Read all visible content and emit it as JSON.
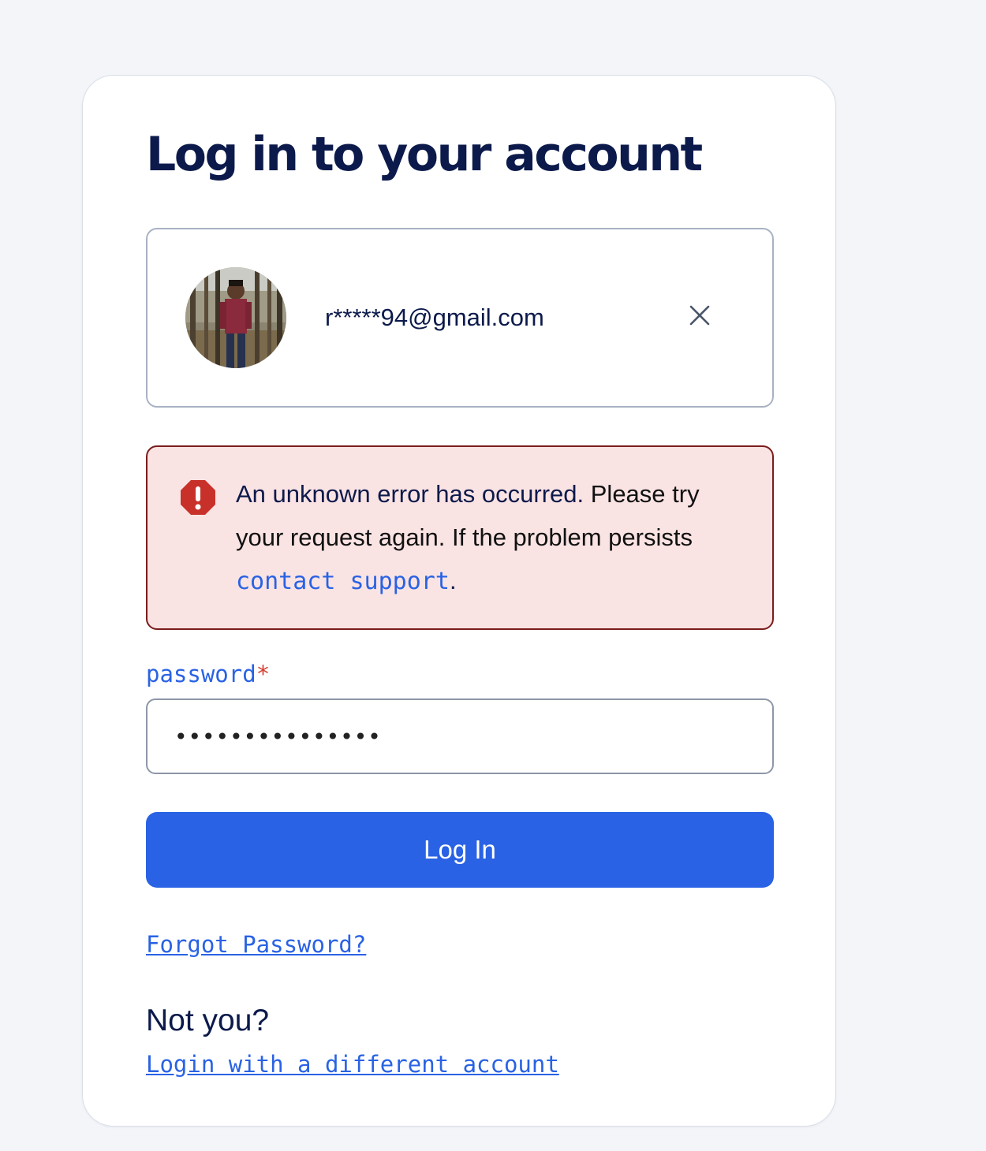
{
  "title": "Log in to your account",
  "account": {
    "email": "r*****94@gmail.com",
    "avatar_icon": "user-photo",
    "close_icon": "close-icon"
  },
  "alert": {
    "icon": "error-octagon-icon",
    "heading": "An unknown error has occurred.",
    "detail": "Please try your request again. If the problem persists",
    "link": "contact support",
    "trailing": "."
  },
  "password": {
    "label": "password",
    "required_mark": "*",
    "value": "•••••••••••••••"
  },
  "login_button": "Log In",
  "forgot_link": "Forgot Password?",
  "not_you": {
    "text": "Not you?",
    "link": "Login with a different account"
  },
  "colors": {
    "background": "#f3f5f9",
    "primary": "#2962e4",
    "heading": "#0c1a4b",
    "alert_bg": "#fae3e3",
    "alert_border": "#7a1c1c",
    "alert_icon": "#c8312a",
    "required": "#d5402f"
  }
}
